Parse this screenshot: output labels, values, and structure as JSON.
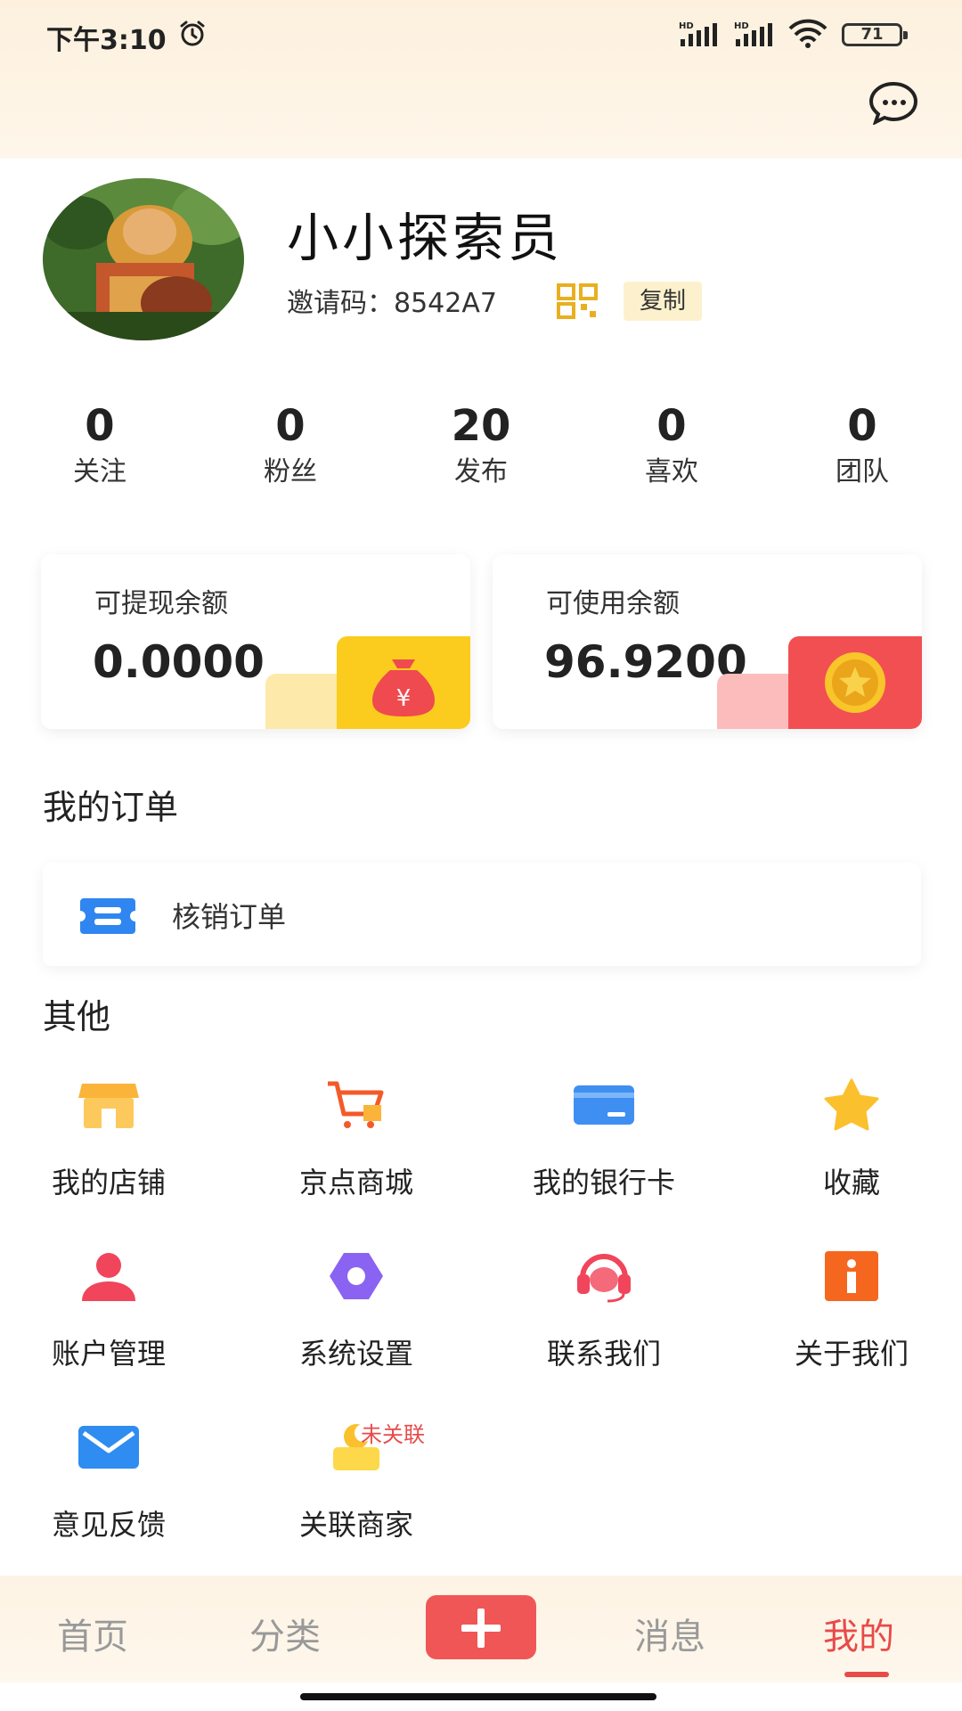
{
  "status_bar": {
    "time": "下午3:10",
    "battery": "71",
    "network_1": "HD",
    "network_2": "HD"
  },
  "profile": {
    "username": "小小探索员",
    "invite_label": "邀请码：",
    "invite_code": "8542A7",
    "copy_label": "复制"
  },
  "stats": [
    {
      "value": "0",
      "label": "关注"
    },
    {
      "value": "0",
      "label": "粉丝"
    },
    {
      "value": "20",
      "label": "发布"
    },
    {
      "value": "0",
      "label": "喜欢"
    },
    {
      "value": "0",
      "label": "团队"
    }
  ],
  "balances": [
    {
      "title": "可提现余额",
      "value": "0.0000",
      "accent": "#fbcc1d",
      "accent_light": "#fde9a9"
    },
    {
      "title": "可使用余额",
      "value": "96.9200",
      "accent": "#f24f52",
      "accent_light": "#fdbcbc"
    }
  ],
  "orders": {
    "section_title": "我的订单",
    "item_label": "核销订单"
  },
  "others": {
    "section_title": "其他",
    "items": [
      {
        "label": "我的店铺",
        "icon": "shop-icon"
      },
      {
        "label": "京点商城",
        "icon": "cart-icon"
      },
      {
        "label": "我的银行卡",
        "icon": "bank-card-icon"
      },
      {
        "label": "收藏",
        "icon": "star-icon"
      },
      {
        "label": "账户管理",
        "icon": "user-icon"
      },
      {
        "label": "系统设置",
        "icon": "settings-icon"
      },
      {
        "label": "联系我们",
        "icon": "headset-icon"
      },
      {
        "label": "关于我们",
        "icon": "info-icon"
      },
      {
        "label": "意见反馈",
        "icon": "mail-icon"
      },
      {
        "label": "关联商家",
        "icon": "merchant-icon",
        "badge": "未关联"
      }
    ]
  },
  "tabbar": {
    "tabs": [
      "首页",
      "分类",
      "消息",
      "我的"
    ],
    "active": "我的",
    "active_color": "#e84a4a"
  }
}
